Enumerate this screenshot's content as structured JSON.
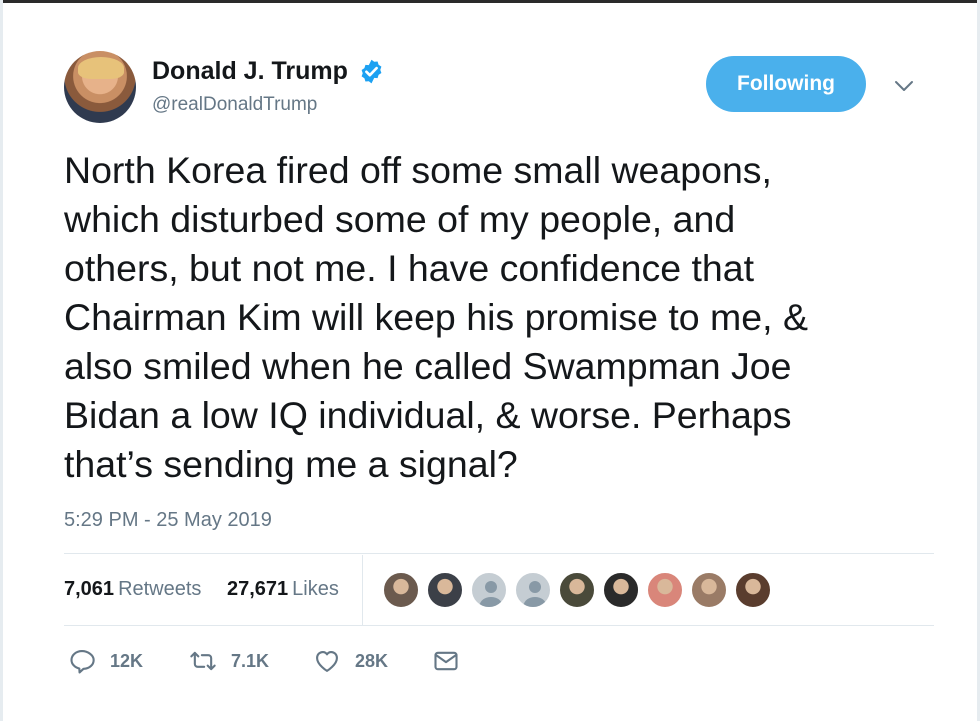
{
  "author": {
    "display_name": "Donald J. Trump",
    "handle": "@realDonaldTrump",
    "verified": true,
    "avatar_icon": "profile-photo"
  },
  "follow_button": {
    "label": "Following"
  },
  "tweet": {
    "text": "North Korea fired off some small weapons,\nwhich disturbed some of my people, and\nothers, but not me. I have confidence that\nChairman Kim will keep his promise to me, &\nalso smiled when he called Swampman Joe\nBidan a low IQ individual, & worse. Perhaps\nthat’s sending me a signal?",
    "timestamp": "5:29 PM - 25 May 2019"
  },
  "stats": {
    "retweets_count": "7,061",
    "retweets_label": "Retweets",
    "likes_count": "27,671",
    "likes_label": "Likes"
  },
  "liked_by_avatars": [
    {
      "name": "liker-avatar-1",
      "color": "#6b5a4e"
    },
    {
      "name": "liker-avatar-2",
      "color": "#3c4048"
    },
    {
      "name": "liker-avatar-3",
      "color": "#c5cdd3",
      "default": true
    },
    {
      "name": "liker-avatar-4",
      "color": "#c5cdd3",
      "default": true
    },
    {
      "name": "liker-avatar-5",
      "color": "#4a4a3a"
    },
    {
      "name": "liker-avatar-6",
      "color": "#2a2a2a"
    },
    {
      "name": "liker-avatar-7",
      "color": "#d9867a"
    },
    {
      "name": "liker-avatar-8",
      "color": "#9a7b66"
    },
    {
      "name": "liker-avatar-9",
      "color": "#5a3d2e"
    }
  ],
  "actions": {
    "reply_count": "12K",
    "retweet_count": "7.1K",
    "like_count": "28K"
  },
  "colors": {
    "accent": "#4ab0ec",
    "verified": "#1da1f2",
    "muted_text": "#657786",
    "text": "#14171a",
    "divider": "#e1e8ed"
  }
}
